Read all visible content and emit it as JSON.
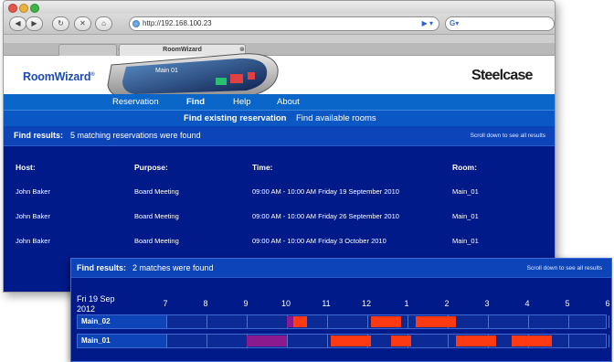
{
  "browser": {
    "url": "http://192.168.100.23",
    "tabs": [
      {
        "label": ""
      },
      {
        "label": "RoomWizard"
      }
    ]
  },
  "header": {
    "logo": "RoomWizard",
    "logo_mark": "®",
    "brand": "Steelcase",
    "device_screen_text": "Main 01"
  },
  "menu": {
    "items": [
      "Reservation",
      "Find",
      "Help",
      "About"
    ],
    "active": "Find"
  },
  "submenu": {
    "items": [
      "Find existing reservation",
      "Find available rooms"
    ],
    "active": "Find existing reservation"
  },
  "results": {
    "label": "Find results:",
    "message": "5 matching reservations were found",
    "hint": "Scroll down to see all results",
    "columns": [
      "Host:",
      "Purpose:",
      "Time:",
      "Room:"
    ],
    "rows": [
      [
        "John Baker",
        "Board Meeting",
        "09:00 AM - 10:00 AM Friday 19 September 2010",
        "Main_01"
      ],
      [
        "John Baker",
        "Board Meeting",
        "09:00 AM - 10:00 AM Friday 26 September 2010",
        "Main_01"
      ],
      [
        "John Baker",
        "Board Meeting",
        "09:00 AM - 10:00 AM Friday 3 October 2010",
        "Main_01"
      ]
    ]
  },
  "overlay": {
    "label": "Find results:",
    "message": "2 matches were found",
    "hint": "Scroll down to see all results",
    "date_line1": "Fri 19 Sep",
    "date_line2": "2012",
    "hours": [
      "7",
      "8",
      "9",
      "10",
      "11",
      "12",
      "1",
      "2",
      "3",
      "4",
      "5",
      "6"
    ],
    "rooms": [
      {
        "name": "Main_02",
        "bookings": [
          [
            10.0,
            10.15,
            "#8b1a8e"
          ],
          [
            10.15,
            10.5,
            "#ff3a12"
          ],
          [
            12.1,
            12.85,
            "#ff3a12"
          ],
          [
            13.2,
            14.2,
            "#ff3a12"
          ]
        ]
      },
      {
        "name": "Main_01",
        "bookings": [
          [
            9.0,
            10.0,
            "#8b1a8e"
          ],
          [
            11.1,
            12.1,
            "#ff3a12"
          ],
          [
            12.6,
            13.1,
            "#ff3a12"
          ],
          [
            14.2,
            15.2,
            "#ff3a12"
          ],
          [
            15.6,
            16.6,
            "#ff3a12"
          ]
        ]
      }
    ]
  },
  "colors": {
    "page_bg": "#001a8a",
    "menu": "#0a66c8",
    "busy": "#ff3a12",
    "pending": "#8b1a8e"
  }
}
